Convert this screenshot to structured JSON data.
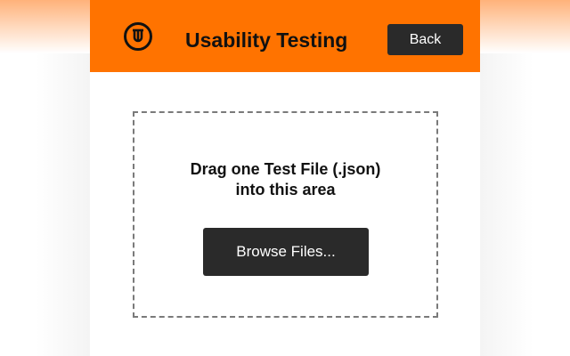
{
  "header": {
    "title": "Usability Testing",
    "back_label": "Back",
    "logo_icon": "usability-testing-logo-icon",
    "accent_color": "#ff7300"
  },
  "dropzone": {
    "line1": "Drag one Test File (.json)",
    "line2": "into this area",
    "browse_label": "Browse Files..."
  }
}
